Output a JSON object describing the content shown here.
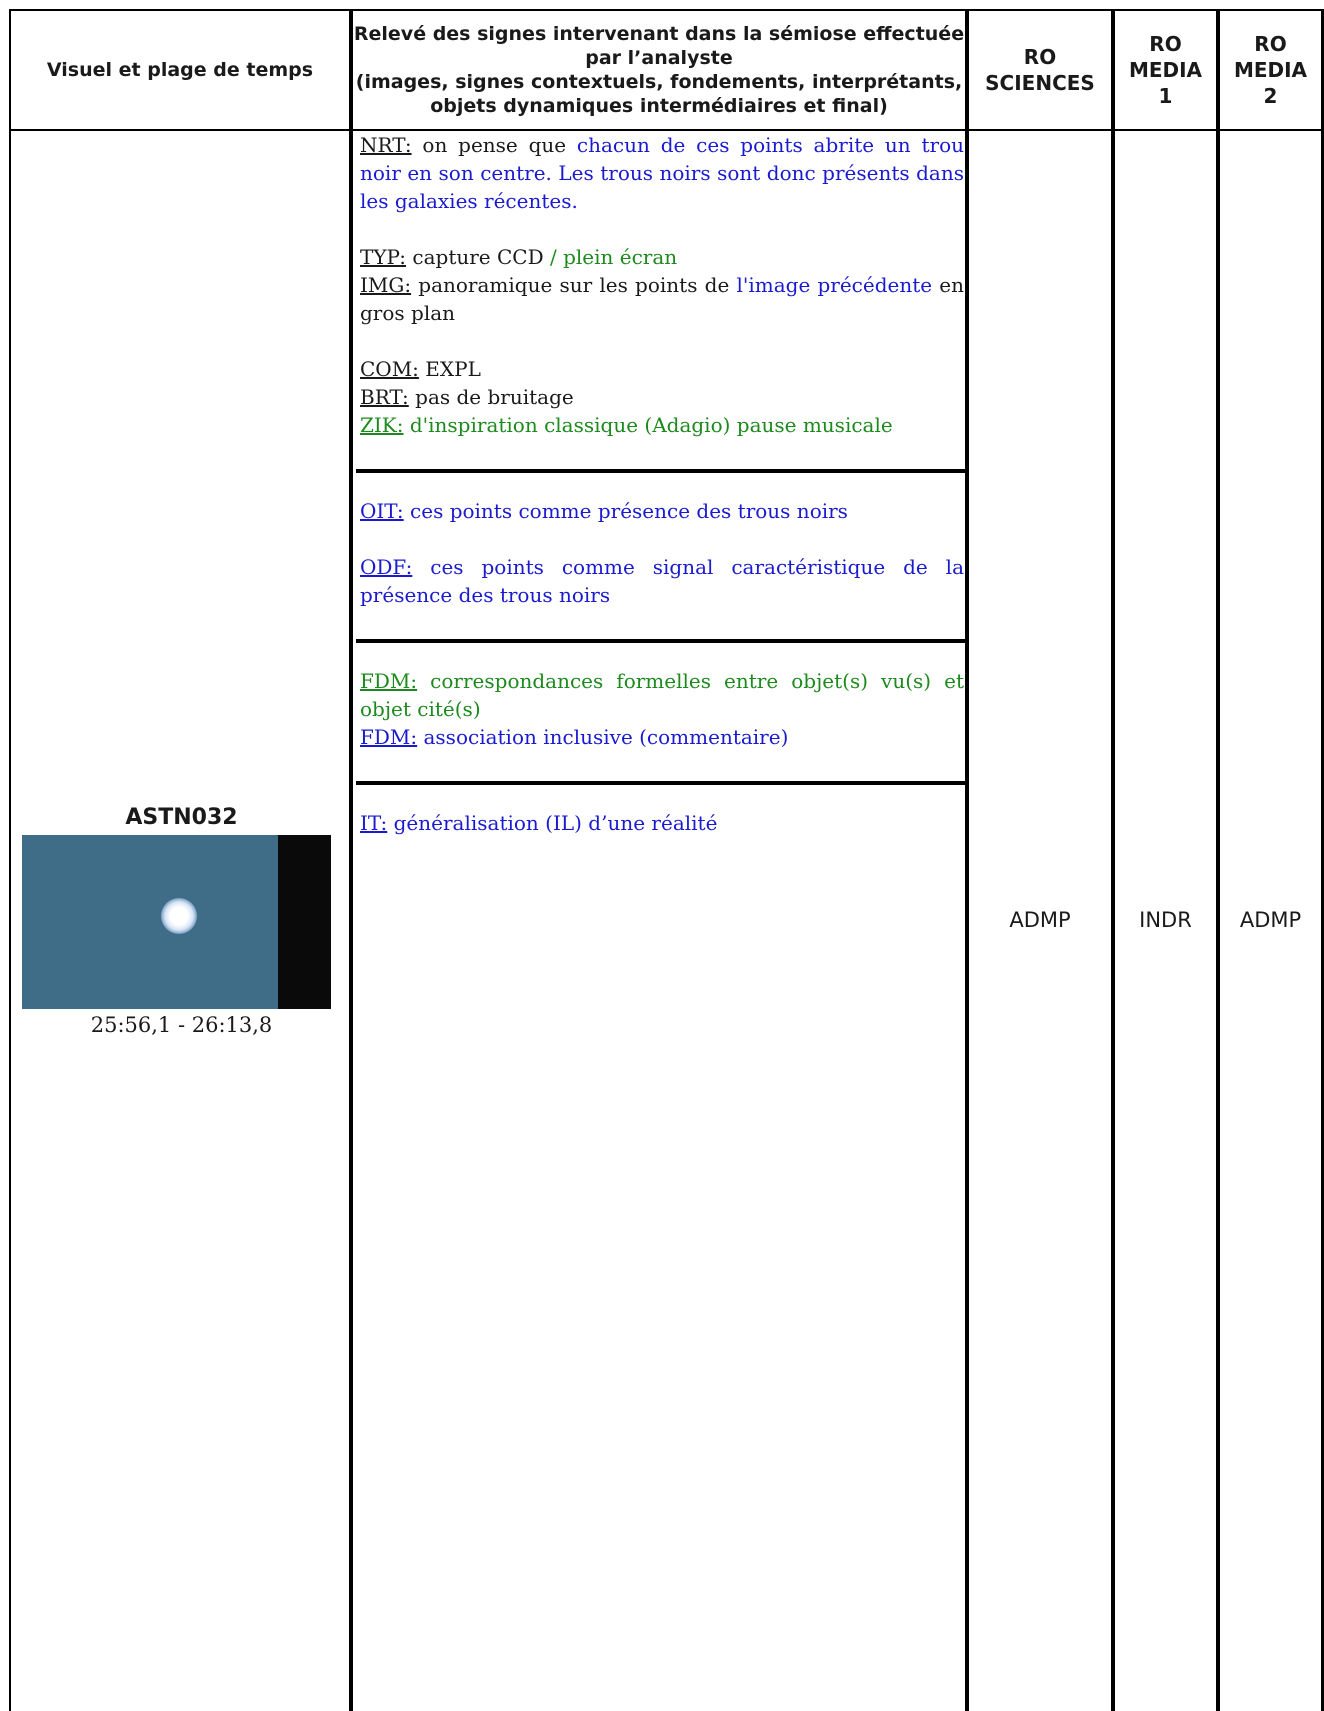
{
  "headers": {
    "col1": "Visuel et plage de temps",
    "col2": [
      "Relevé des signes intervenant dans la sémiose effectuée",
      "par l’analyste",
      "(images, signes contextuels, fondements, interprétants,",
      "objets dynamiques intermédiaires et final)"
    ],
    "col3": [
      "RO",
      "SCIENCES"
    ],
    "col4": [
      "RO",
      "MEDIA",
      "1"
    ],
    "col5": [
      "RO",
      "MEDIA",
      "2"
    ]
  },
  "visual": {
    "title": "ASTN032",
    "timecode": "25:56,1 - 26:13,8"
  },
  "analysis": {
    "nrt": {
      "label": "NRT:",
      "t1": " on pense que ",
      "t2": "chacun de ces points abrite un trou noir en son centre. Les trous noirs sont donc présents dans les galaxies récentes."
    },
    "typ": {
      "label": "TYP:",
      "t1": " capture CCD",
      "t2": " / plein écran"
    },
    "img": {
      "label": "IMG:",
      "t1": " panoramique sur les points de ",
      "t2": "l'image précédente",
      "t3": " en gros plan"
    },
    "com": {
      "label": "COM:",
      "t1": " EXPL"
    },
    "brt": {
      "label": "BRT:",
      "t1": " pas de bruitage"
    },
    "zik": {
      "label": "ZIK:",
      "t1": " d'inspiration classique (Adagio) pause musicale"
    },
    "oit": {
      "label": "OIT:",
      "t1": " ces points comme présence des trous noirs"
    },
    "odf": {
      "label": "ODF:",
      "t1": " ces points comme signal caractéristique de la présence des trous noirs"
    },
    "fdm1": {
      "label": "FDM:",
      "t1": " correspondances formelles entre objet(s) vu(s) et objet cité(s)"
    },
    "fdm2": {
      "label": "FDM:",
      "t1": " association inclusive (commentaire)"
    },
    "it": {
      "label": "IT:",
      "t1": " généralisation (IL) d’une réalité"
    }
  },
  "values": {
    "ro_sciences": "ADMP",
    "ro_media1": "INDR",
    "ro_media2": "ADMP"
  },
  "colors": {
    "blue": "#1a1ad0",
    "green": "#1c8a1c",
    "border": "#000000"
  }
}
